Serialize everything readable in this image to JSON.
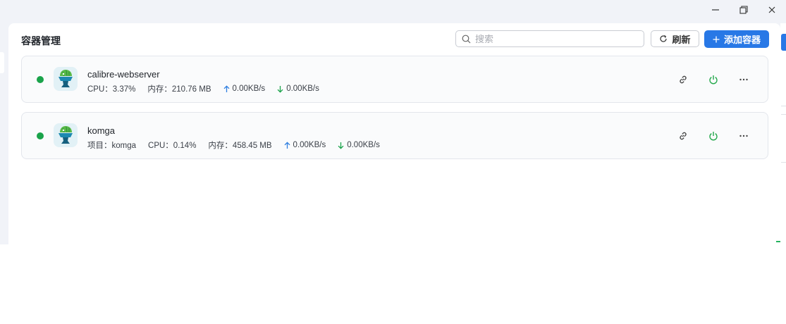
{
  "header": {
    "title": "容器管理",
    "search_placeholder": "搜索",
    "search_value": "",
    "refresh_label": "刷新",
    "add_label": "添加容器"
  },
  "containers": [
    {
      "name": "calibre-webserver",
      "status": "running",
      "stats": [
        {
          "kind": "cpu",
          "text": "CPU：3.37%"
        },
        {
          "kind": "mem",
          "text": "内存：210.76 MB"
        },
        {
          "kind": "up",
          "text": "0.00KB/s"
        },
        {
          "kind": "down",
          "text": "0.00KB/s"
        }
      ]
    },
    {
      "name": "komga",
      "status": "running",
      "stats": [
        {
          "kind": "project",
          "text": "项目：komga"
        },
        {
          "kind": "cpu",
          "text": "CPU：0.14%"
        },
        {
          "kind": "mem",
          "text": "内存：458.45 MB"
        },
        {
          "kind": "up",
          "text": "0.00KB/s"
        },
        {
          "kind": "down",
          "text": "0.00KB/s"
        }
      ]
    }
  ],
  "icons": {
    "minimize": "minimize-icon",
    "maximize": "maximize-icon",
    "close": "close-icon",
    "search": "search-icon",
    "refresh": "refresh-icon",
    "add": "plus-icon",
    "link": "link-icon",
    "power": "power-icon",
    "more": "more-icon",
    "upload": "arrow-up-icon",
    "download": "arrow-down-icon"
  },
  "colors": {
    "accent": "#2878e6",
    "running": "#1aa34a",
    "power": "#22a84a",
    "background": "#f1f3f8"
  }
}
